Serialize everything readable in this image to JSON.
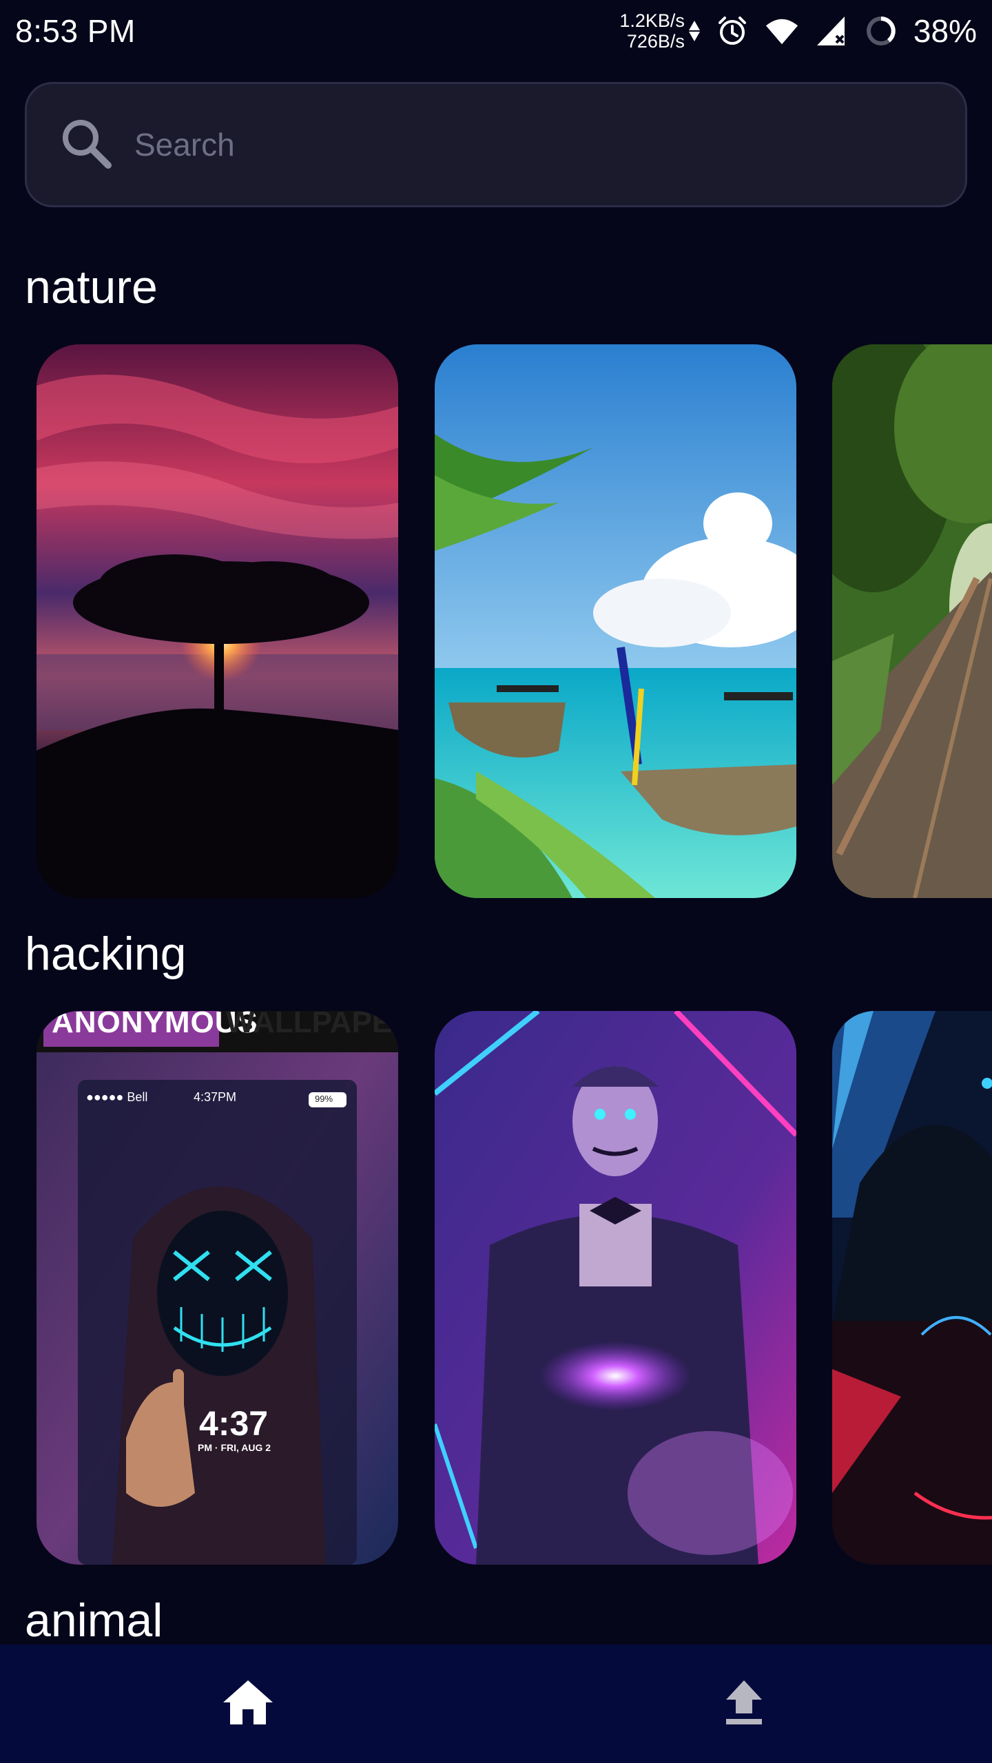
{
  "status_bar": {
    "time": "8:53 PM",
    "upload_rate": "1.2KB/s",
    "download_rate": "726B/s",
    "battery_percent": "38%",
    "icons": [
      "alarm-icon",
      "wifi-icon",
      "signal-icon",
      "battery-ring-icon"
    ]
  },
  "search": {
    "placeholder": "Search",
    "value": ""
  },
  "sections": [
    {
      "title": "nature",
      "cards": [
        "sunset-tree-wallpaper",
        "tropical-boats-wallpaper",
        "forest-railway-wallpaper"
      ]
    },
    {
      "title": "hacking",
      "cards": [
        "neon-mask-hacker-wallpaper",
        "neon-anonymous-man-wallpaper",
        "hooded-hacker-wallpaper"
      ]
    },
    {
      "title": "animal",
      "cards": []
    }
  ],
  "hacking_card_1": {
    "banner_left": "ANONYMOUS",
    "banner_right": "WALLPAPERS",
    "phone_carrier": "●●●●● Bell",
    "phone_time": "4:37PM",
    "phone_battery": "99%",
    "clock_time": "4:37",
    "clock_date": "PM · FRI, AUG 2"
  },
  "bottom_nav": {
    "items": [
      {
        "icon": "home-icon",
        "active": true
      },
      {
        "icon": "upload-icon",
        "active": false
      }
    ]
  },
  "colors": {
    "background": "#06061a",
    "search_bg": "#1a1a2c",
    "nav_bg": "#040a3c",
    "active_icon": "#ffffff",
    "inactive_icon": "#b7b7c2"
  }
}
